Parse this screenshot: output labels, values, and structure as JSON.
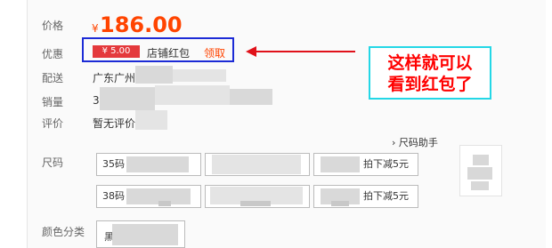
{
  "product": {
    "price_label": "价格",
    "currency": "¥",
    "price": "186.00",
    "promo_label": "优惠",
    "coupon": {
      "amount": "¥ 5.00",
      "name": "店铺红包",
      "claim": "领取"
    },
    "shipping_label": "配送",
    "shipping_value": "广东广州",
    "sales_label": "销量",
    "sales_value": "3",
    "rating_label": "评价",
    "rating_value": "暂无评价",
    "size_label": "尺码",
    "size_helper": "尺码助手",
    "sizes": [
      {
        "name": "35码",
        "tail": "拍下减5元"
      },
      {
        "name": "38码",
        "tail": "拍下减5元"
      }
    ],
    "color_label": "颜色分类",
    "color_value": "黑"
  },
  "annotation": {
    "line1": "这样就可以",
    "line2": "看到红包了",
    "arrow_color": "#e0111a",
    "box_color": "#1c2bd6",
    "callout_border": "#24d7e6",
    "text_color": "#ff0000"
  }
}
